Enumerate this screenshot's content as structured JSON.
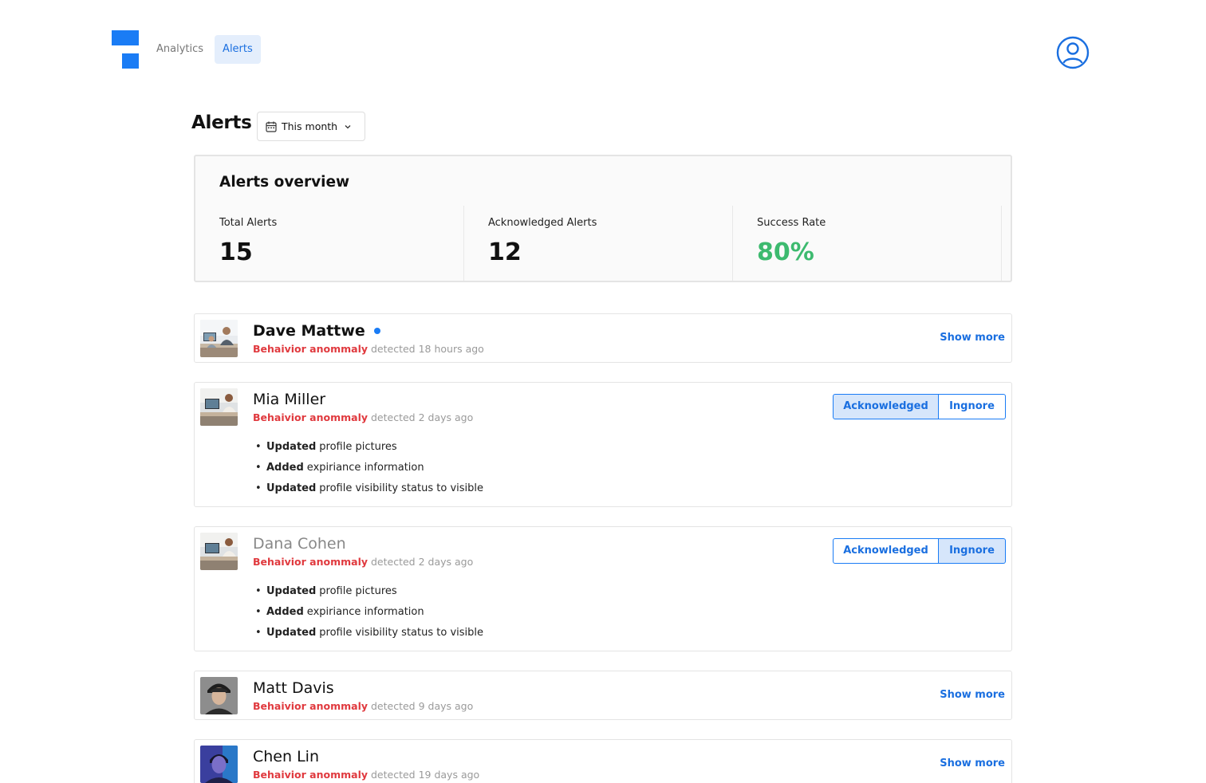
{
  "nav": {
    "items": [
      {
        "label": "Analytics",
        "active": false
      },
      {
        "label": "Alerts",
        "active": true
      }
    ]
  },
  "page": {
    "title": "Alerts",
    "period": "This month"
  },
  "overview": {
    "title": "Alerts overview",
    "stats": [
      {
        "label": "Total Alerts",
        "value": "15"
      },
      {
        "label": "Acknowledged Alerts",
        "value": "12"
      },
      {
        "label": "Success Rate",
        "value": "80%"
      }
    ]
  },
  "alerts": [
    {
      "name": "Dave Mattwe",
      "unread": true,
      "type": "Behaivior anommaly",
      "detected": "detected 18 hours ago",
      "action": "Show more"
    },
    {
      "name": "Mia Miller",
      "type": "Behaivior anommaly",
      "detected": "detected 2 days ago",
      "ack_label": "Acknowledged",
      "ignore_label": "Ingnore",
      "selected": "Acknowledged",
      "changes": [
        {
          "verb": "Updated",
          "text": "profile pictures"
        },
        {
          "verb": "Added",
          "text": "expiriance information"
        },
        {
          "verb": "Updated",
          "text": "profile visibility status to visible"
        }
      ]
    },
    {
      "name": "Dana Cohen",
      "type": "Behaivior anommaly",
      "detected": "detected 2 days ago",
      "ack_label": "Acknowledged",
      "ignore_label": "Ingnore",
      "selected": "Ingnore",
      "changes": [
        {
          "verb": "Updated",
          "text": "profile pictures"
        },
        {
          "verb": "Added",
          "text": "expiriance information"
        },
        {
          "verb": "Updated",
          "text": "profile visibility status to visible"
        }
      ]
    },
    {
      "name": "Matt Davis",
      "type": "Behaivior anommaly",
      "detected": "detected 9 days ago",
      "action": "Show more"
    },
    {
      "name": "Chen Lin",
      "type": "Behaivior anommaly",
      "detected": "detected 19 days ago",
      "action": "Show more"
    }
  ],
  "colors": {
    "accent": "#1a7cf5",
    "anomaly": "#e0393e",
    "success": "#3dba6f"
  }
}
